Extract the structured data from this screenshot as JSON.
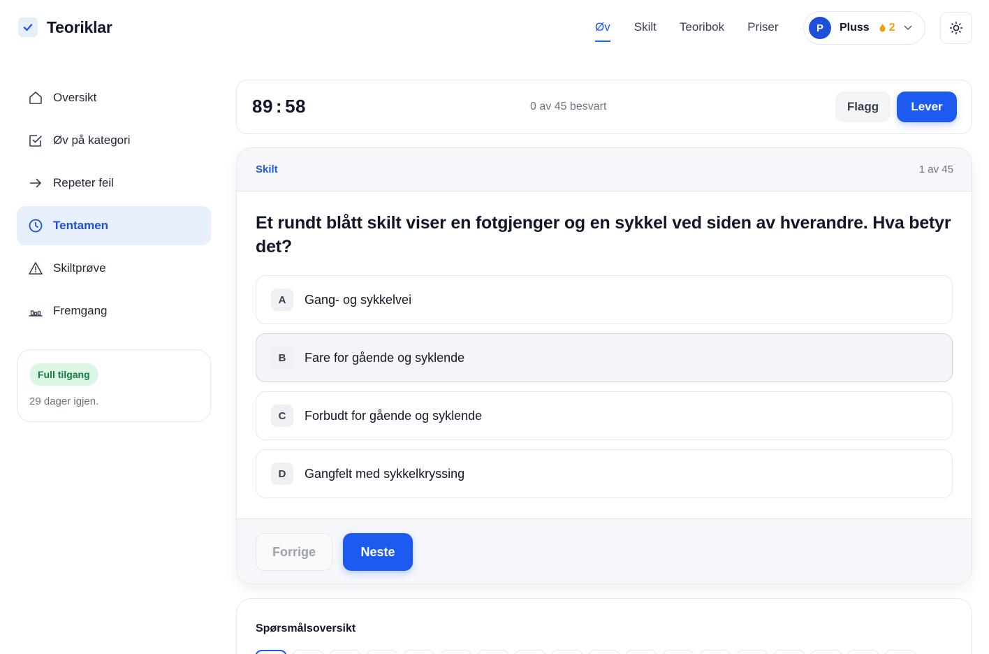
{
  "app": {
    "name": "Teoriklar"
  },
  "nav": {
    "items": [
      {
        "label": "Øv",
        "active": true
      },
      {
        "label": "Skilt",
        "active": false
      },
      {
        "label": "Teoribok",
        "active": false
      },
      {
        "label": "Priser",
        "active": false
      }
    ]
  },
  "account": {
    "avatar_initial": "P",
    "plan": "Pluss",
    "streak": "2",
    "streak_icon": "flame-icon",
    "accent": "#1d5bf0"
  },
  "sidebar": {
    "items": [
      {
        "label": "Oversikt",
        "icon": "home-icon",
        "active": false
      },
      {
        "label": "Øv på kategori",
        "icon": "checkbox-icon",
        "active": false
      },
      {
        "label": "Repeter feil",
        "icon": "arrow-right-icon",
        "active": false
      },
      {
        "label": "Tentamen",
        "icon": "clock-icon",
        "active": true
      },
      {
        "label": "Skiltprøve",
        "icon": "warning-icon",
        "active": false
      },
      {
        "label": "Fremgang",
        "icon": "bar-chart-icon",
        "active": false
      }
    ],
    "access": {
      "badge": "Full tilgang",
      "text": "29 dager igjen."
    }
  },
  "exam": {
    "timer_minutes": "89",
    "timer_sep": ":",
    "timer_seconds": "58",
    "answered": "0 av 45 besvart",
    "flag_label": "Flagg",
    "submit_label": "Lever"
  },
  "question": {
    "category": "Skilt",
    "counter": "1 av 45",
    "text": "Et rundt blått skilt viser en fotgjenger og en sykkel ved siden av hverandre. Hva betyr det?",
    "options": [
      {
        "letter": "A",
        "text": "Gang- og sykkelvei"
      },
      {
        "letter": "B",
        "text": "Fare for gående og syklende"
      },
      {
        "letter": "C",
        "text": "Forbudt for gående og syklende"
      },
      {
        "letter": "D",
        "text": "Gangfelt med sykkelkryssing"
      }
    ],
    "prev_label": "Forrige",
    "next_label": "Neste"
  },
  "overview": {
    "title": "Spørsmålsoversikt"
  }
}
